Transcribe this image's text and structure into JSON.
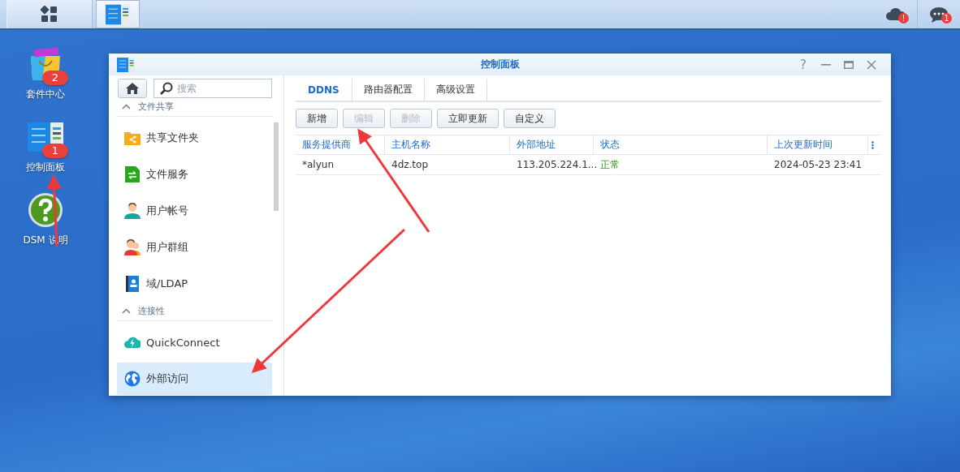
{
  "taskbar": {
    "apps": [
      {
        "selected": false
      },
      {
        "selected": true
      }
    ],
    "tray_badges": [
      "!",
      "1"
    ]
  },
  "desktop_icons": [
    {
      "label": "套件中心",
      "badge": "2"
    },
    {
      "label": "控制面板",
      "badge": "1"
    },
    {
      "label": "DSM 说明"
    }
  ],
  "window": {
    "title": "控制面板",
    "help_glyph": "?"
  },
  "sidebar": {
    "search": {
      "placeholder": "搜索"
    },
    "sections": [
      {
        "title": "文件共享",
        "expanded": true,
        "items": [
          {
            "label": "共享文件夹",
            "selected": false
          },
          {
            "label": "文件服务",
            "selected": false
          },
          {
            "label": "用户帐号",
            "selected": false
          },
          {
            "label": "用户群组",
            "selected": false
          },
          {
            "label": "域/LDAP",
            "selected": false
          }
        ]
      },
      {
        "title": "连接性",
        "expanded": true,
        "items": [
          {
            "label": "QuickConnect",
            "selected": false
          },
          {
            "label": "外部访问",
            "selected": true
          }
        ]
      }
    ]
  },
  "tabs": [
    {
      "label": "DDNS",
      "selected": true
    },
    {
      "label": "路由器配置",
      "selected": false
    },
    {
      "label": "高级设置",
      "selected": false
    }
  ],
  "toolbar": [
    {
      "label": "新增",
      "disabled": false
    },
    {
      "label": "编辑",
      "disabled": true
    },
    {
      "label": "删除",
      "disabled": true
    },
    {
      "label": "立即更新",
      "disabled": false
    },
    {
      "label": "自定义",
      "disabled": false
    }
  ],
  "table": {
    "columns": [
      "服务提供商",
      "主机名称",
      "外部地址",
      "状态",
      "上次更新时间"
    ],
    "rows": [
      [
        "*alyun",
        "4dz.top",
        "113.205.224.1...",
        "正常",
        "2024-05-23 23:41"
      ]
    ]
  }
}
